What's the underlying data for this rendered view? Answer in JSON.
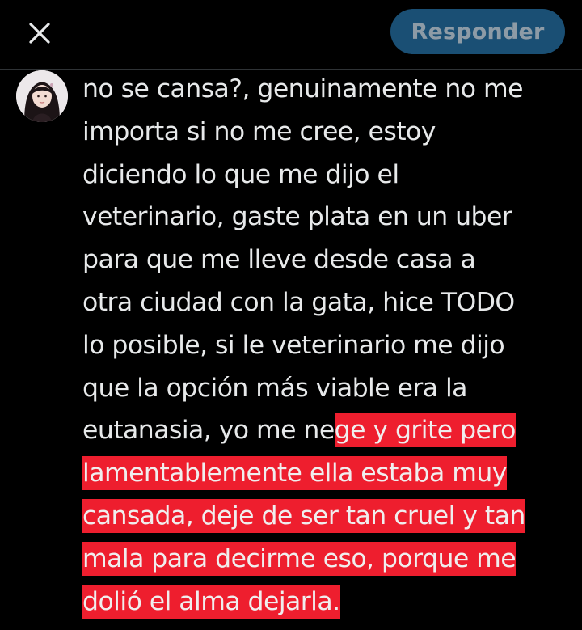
{
  "header": {
    "close_icon": "close-icon",
    "reply_label": "Responder",
    "reply_bg": "#1a4f74"
  },
  "reply": {
    "avatar_icon": "user-avatar",
    "text_plain": "no se cansa?, genuinamente no me\nimporta si no me cree, estoy\ndiciendo lo que me dijo el\nveterinario, gaste plata en un uber\npara que me lleve desde casa a\notra ciudad con la gata, hice TODO\nlo posible, si le veterinario me dijo\nque la opción más viable era la\neutanasia, yo me ne",
    "text_highlighted_1": "ge y grite pero",
    "text_highlighted_2": "lamentablemente ella estaba muy",
    "text_highlighted_3": "cansada, deje de ser tan cruel y tan",
    "text_highlighted_4": "mala para decirme eso, porque me",
    "text_highlighted_5": "dolió el alma dejarla.",
    "highlight_color": "#ee1e2e"
  }
}
